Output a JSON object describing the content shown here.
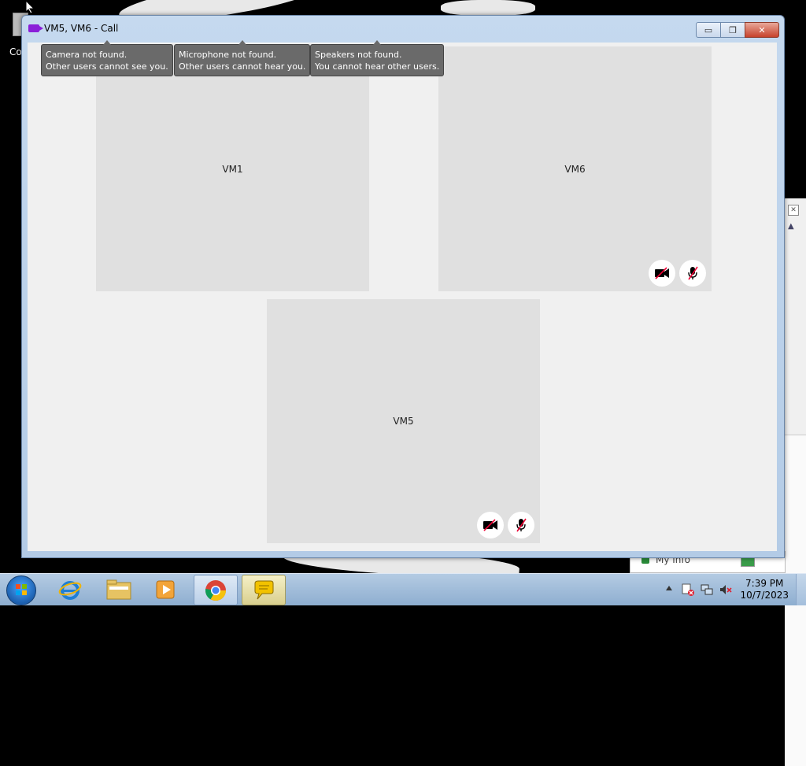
{
  "desktop": {
    "icon_label": "Co"
  },
  "window": {
    "title": "VM5, VM6 - Call",
    "minimize_label": "▭",
    "maximize_label": "❐",
    "close_label": "✕"
  },
  "notices": [
    {
      "line1": "Camera not found.",
      "line2": "Other users cannot see you."
    },
    {
      "line1": "Microphone not found.",
      "line2": "Other users cannot hear you."
    },
    {
      "line1": "Speakers not found.",
      "line2": "You cannot hear other users."
    }
  ],
  "participants": [
    {
      "name": "VM1",
      "camera": "camera-icon",
      "mic": "microphone-icon",
      "muted_indicators": false
    },
    {
      "name": "VM6",
      "camera": "camera-off-icon",
      "mic": "microphone-off-icon",
      "muted_indicators": true
    },
    {
      "name": "VM5",
      "camera": "camera-off-icon",
      "mic": "microphone-off-icon",
      "muted_indicators": true
    }
  ],
  "background_window": {
    "info_label": "My Info"
  },
  "taskbar": {
    "apps": [
      "internet-explorer",
      "file-explorer",
      "media-player",
      "chrome",
      "messenger"
    ],
    "clock_time": "7:39 PM",
    "clock_date": "10/7/2023"
  },
  "colors": {
    "accent": "#8a1fd8",
    "tile": "#e0e0e0",
    "tooltip": "#6a6a6a"
  }
}
